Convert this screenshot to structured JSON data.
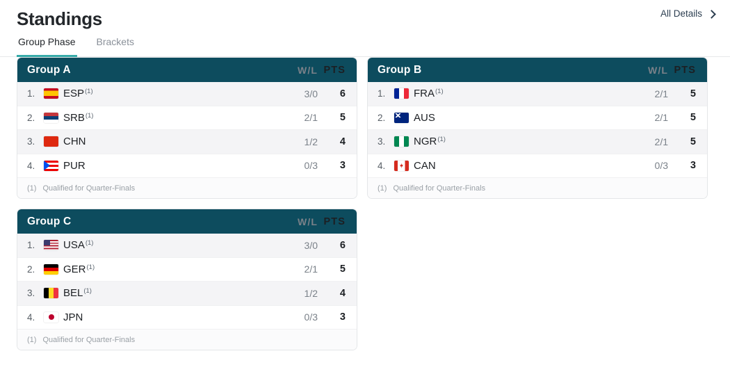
{
  "header": {
    "title": "Standings",
    "all_details_label": "All Details",
    "chevron_icon": "chevron-right-icon"
  },
  "tabs": [
    {
      "label": "Group Phase",
      "active": true
    },
    {
      "label": "Brackets",
      "active": false
    }
  ],
  "columns": {
    "wl": "W/L",
    "pts": "PTS"
  },
  "accent": {
    "tab_underline": "#35aaa8",
    "group_header_bg": "#0d4c5e",
    "stripe_bg": "#f4f4f6"
  },
  "footnote": {
    "mark": "(1)",
    "text": "Qualified for Quarter-Finals"
  },
  "groups": [
    {
      "name": "Group A",
      "teams": [
        {
          "rank": "1.",
          "code": "ESP",
          "flag": "f-esp",
          "flag_name": "flag-spain",
          "qualified": "(1)",
          "wl": "3/0",
          "pts": "6"
        },
        {
          "rank": "2.",
          "code": "SRB",
          "flag": "f-srb",
          "flag_name": "flag-serbia",
          "qualified": "(1)",
          "wl": "2/1",
          "pts": "5"
        },
        {
          "rank": "3.",
          "code": "CHN",
          "flag": "f-chn",
          "flag_name": "flag-china",
          "qualified": "",
          "wl": "1/2",
          "pts": "4"
        },
        {
          "rank": "4.",
          "code": "PUR",
          "flag": "f-pur",
          "flag_name": "flag-puerto-rico",
          "qualified": "",
          "wl": "0/3",
          "pts": "3"
        }
      ]
    },
    {
      "name": "Group B",
      "teams": [
        {
          "rank": "1.",
          "code": "FRA",
          "flag": "f-fra",
          "flag_name": "flag-france",
          "qualified": "(1)",
          "wl": "2/1",
          "pts": "5"
        },
        {
          "rank": "2.",
          "code": "AUS",
          "flag": "f-aus",
          "flag_name": "flag-australia",
          "qualified": "",
          "wl": "2/1",
          "pts": "5"
        },
        {
          "rank": "3.",
          "code": "NGR",
          "flag": "f-ngr",
          "flag_name": "flag-nigeria",
          "qualified": "(1)",
          "wl": "2/1",
          "pts": "5"
        },
        {
          "rank": "4.",
          "code": "CAN",
          "flag": "f-can",
          "flag_name": "flag-canada",
          "qualified": "",
          "wl": "0/3",
          "pts": "3"
        }
      ]
    },
    {
      "name": "Group C",
      "teams": [
        {
          "rank": "1.",
          "code": "USA",
          "flag": "f-usa",
          "flag_name": "flag-united-states",
          "qualified": "(1)",
          "wl": "3/0",
          "pts": "6"
        },
        {
          "rank": "2.",
          "code": "GER",
          "flag": "f-ger",
          "flag_name": "flag-germany",
          "qualified": "(1)",
          "wl": "2/1",
          "pts": "5"
        },
        {
          "rank": "3.",
          "code": "BEL",
          "flag": "f-bel",
          "flag_name": "flag-belgium",
          "qualified": "(1)",
          "wl": "1/2",
          "pts": "4"
        },
        {
          "rank": "4.",
          "code": "JPN",
          "flag": "f-jpn",
          "flag_name": "flag-japan",
          "qualified": "",
          "wl": "0/3",
          "pts": "3"
        }
      ]
    }
  ]
}
